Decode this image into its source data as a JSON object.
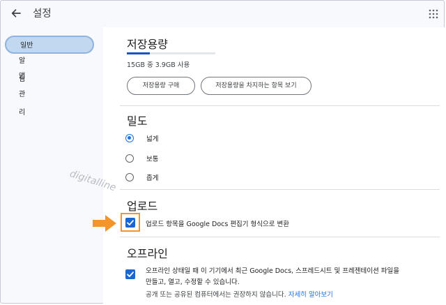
{
  "app": {
    "title": "설정"
  },
  "icons": {
    "back": "arrow-left-icon",
    "apps": "grid-dots-icon",
    "pointer": "orange-arrow-icon",
    "check": "checkmark-icon"
  },
  "colors": {
    "accent": "#1a73e8",
    "nav_active_bg": "#c2d7f0",
    "highlight": "#f4952a"
  },
  "sidebar": {
    "items": [
      {
        "label": "일반",
        "active": true
      },
      {
        "label": "알림",
        "active": false
      },
      {
        "label": "앱 관리",
        "active": false
      }
    ]
  },
  "storage": {
    "title": "저장용량",
    "usage_text": "15GB 중 3.9GB 사용",
    "usage_fraction": 0.26,
    "buy_button": "저장용량 구매",
    "view_button": "저장용량을 차지하는 항목 보기"
  },
  "density": {
    "title": "밀도",
    "options": [
      {
        "label": "넓게",
        "checked": true
      },
      {
        "label": "보통",
        "checked": false
      },
      {
        "label": "좁게",
        "checked": false
      }
    ]
  },
  "upload": {
    "title": "업로드",
    "convert_label": "업로드 항목을 Google Docs 편집기 형식으로 변환",
    "convert_checked": true
  },
  "offline": {
    "title": "오프라인",
    "line1": "오프라인 상태일 때 이 기기에서 최근 Google Docs, 스프레드시트 및 프레젠테이션 파일을",
    "line2": "만들고, 열고, 수정할 수 있습니다.",
    "note": "공개 또는 공유된 컴퓨터에서는 권장하지 않습니다.",
    "link": "자세히 알아보기",
    "checked": true
  },
  "watermark": "digitalline"
}
